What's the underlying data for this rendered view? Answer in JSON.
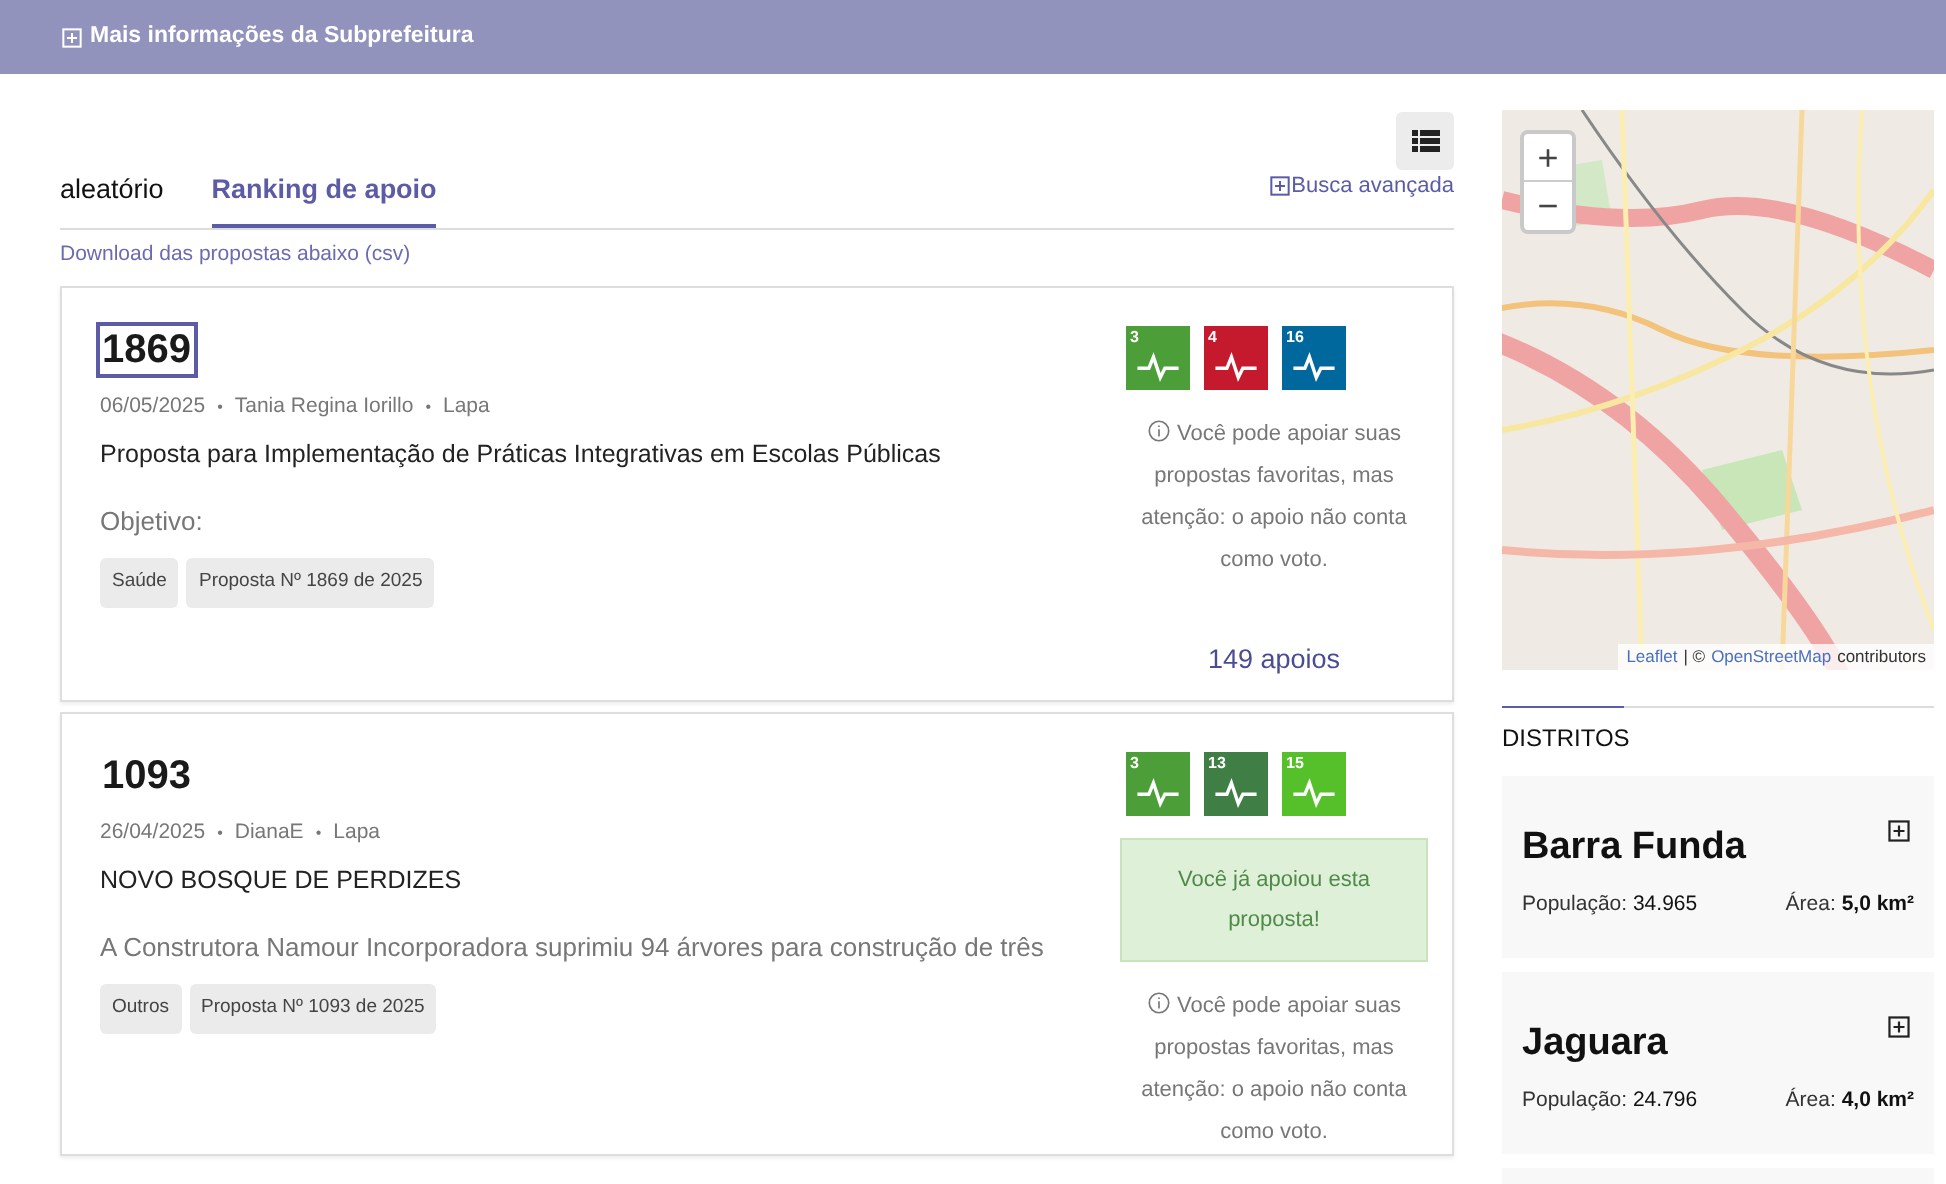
{
  "header": {
    "label": "Mais informações da Subprefeitura"
  },
  "tabs": [
    {
      "label": "aleatório",
      "selected": false
    },
    {
      "label": "Ranking de apoio",
      "selected": true
    }
  ],
  "advanced_search": "Busca avançada",
  "download_link": "Download das propostas abaixo (csv)",
  "proposals": [
    {
      "number": "1869",
      "focused": true,
      "separator": "•",
      "date": "06/05/2025",
      "author": "Tania Regina Iorillo",
      "district": "Lapa",
      "title": "Proposta para Implementação de Práticas Integrativas em Escolas Públicas",
      "summary": "Objetivo:",
      "tags": [
        "Saúde",
        "Proposta Nº 1869 de 2025"
      ],
      "goals": [
        {
          "number": "3",
          "color": "#4c9f38"
        },
        {
          "number": "4",
          "color": "#c5192d"
        },
        {
          "number": "16",
          "color": "#00689d"
        }
      ],
      "supported": false,
      "info": "Você pode apoiar suas propostas favoritas, mas atenção: o apoio não conta como voto.",
      "supports": "149 apoios"
    },
    {
      "number": "1093",
      "focused": false,
      "separator": "•",
      "date": "26/04/2025",
      "author": "DianaE",
      "district": "Lapa",
      "title": "NOVO BOSQUE DE PERDIZES",
      "summary": "A Construtora Namour Incorporadora suprimiu 94 árvores para construção de três",
      "tags": [
        "Outros",
        "Proposta Nº 1093 de 2025"
      ],
      "goals": [
        {
          "number": "3",
          "color": "#4c9f38"
        },
        {
          "number": "13",
          "color": "#3f7e44"
        },
        {
          "number": "15",
          "color": "#56c02b"
        }
      ],
      "supported": true,
      "support_message": "Você já apoiou esta proposta!",
      "info": "Você pode apoiar suas propostas favoritas, mas atenção: o apoio não conta como voto."
    }
  ],
  "map": {
    "zoom_in": "+",
    "zoom_out": "−",
    "attribution_link_1": "Leaflet",
    "attribution_separator": "| ©",
    "attribution_link_2": "OpenStreetMap",
    "attribution_suffix": "contributors"
  },
  "districts": {
    "title": "DISTRITOS",
    "items": [
      {
        "name": "Barra Funda",
        "population_label": "População:",
        "population": "34.965",
        "area_label": "Área:",
        "area": "5,0 km²"
      },
      {
        "name": "Jaguara",
        "population_label": "População:",
        "population": "24.796",
        "area_label": "Área:",
        "area": "4,0 km²"
      }
    ]
  }
}
